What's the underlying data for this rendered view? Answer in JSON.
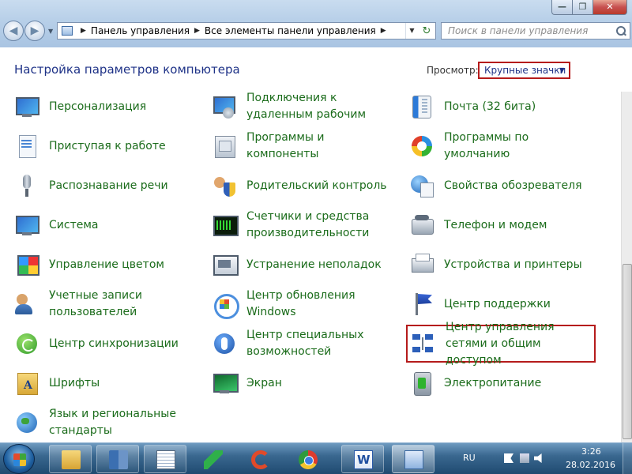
{
  "window": {
    "controls": {
      "minimize": "—",
      "maximize": "❐",
      "close": "✕"
    }
  },
  "address_bar": {
    "crumbs": [
      "Панель управления",
      "Все элементы панели управления"
    ]
  },
  "search": {
    "placeholder": "Поиск в панели управления"
  },
  "header": {
    "title": "Настройка параметров компьютера",
    "view_label": "Просмотр:",
    "view_value": "Крупные значки"
  },
  "items": [
    {
      "label": "Персонализация",
      "icon": "personalization-icon"
    },
    {
      "label": "Приступая к работе",
      "icon": "getting-started-icon"
    },
    {
      "label": "Распознавание речи",
      "icon": "speech-recognition-icon"
    },
    {
      "label": "Система",
      "icon": "system-icon"
    },
    {
      "label": "Управление цветом",
      "icon": "color-management-icon"
    },
    {
      "label": "Учетные записи пользователей",
      "icon": "user-accounts-icon"
    },
    {
      "label": "Центр синхронизации",
      "icon": "sync-center-icon"
    },
    {
      "label": "Шрифты",
      "icon": "fonts-icon"
    },
    {
      "label": "Язык и региональные стандарты",
      "icon": "region-language-icon"
    },
    {
      "label": "Подключения к удаленным рабочим",
      "icon": "remote-desktop-icon"
    },
    {
      "label": "Программы и компоненты",
      "icon": "programs-features-icon"
    },
    {
      "label": "Родительский контроль",
      "icon": "parental-controls-icon"
    },
    {
      "label": "Счетчики и средства производительности",
      "icon": "performance-icon"
    },
    {
      "label": "Устранение неполадок",
      "icon": "troubleshooting-icon"
    },
    {
      "label": "Центр обновления Windows",
      "icon": "windows-update-icon"
    },
    {
      "label": "Центр специальных возможностей",
      "icon": "ease-of-access-icon"
    },
    {
      "label": "Экран",
      "icon": "display-icon"
    },
    {
      "label": "Почта (32 бита)",
      "icon": "mail-icon"
    },
    {
      "label": "Программы по умолчанию",
      "icon": "default-programs-icon"
    },
    {
      "label": "Свойства обозревателя",
      "icon": "internet-options-icon"
    },
    {
      "label": "Телефон и модем",
      "icon": "phone-modem-icon"
    },
    {
      "label": "Устройства и принтеры",
      "icon": "devices-printers-icon"
    },
    {
      "label": "Центр поддержки",
      "icon": "action-center-icon"
    },
    {
      "label": "Центр управления сетями и общим доступом",
      "icon": "network-sharing-icon"
    },
    {
      "label": "Электропитание",
      "icon": "power-options-icon"
    }
  ],
  "taskbar": {
    "apps": [
      "file-explorer-icon",
      "library-icon",
      "notepad-icon",
      "feather-app-icon",
      "c-app-icon",
      "chrome-icon",
      "word-icon",
      "control-panel-icon"
    ],
    "language": "RU",
    "time": "3:26",
    "date": "28.02.2016"
  },
  "colors": {
    "link_green": "#1b6c1b",
    "title_blue": "#1e3287",
    "highlight_red": "#b51b1b"
  }
}
